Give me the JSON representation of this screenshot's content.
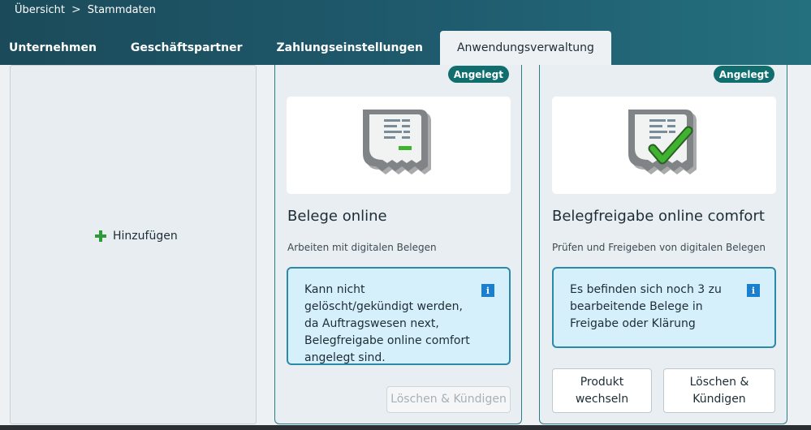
{
  "breadcrumb": {
    "items": [
      "Übersicht",
      "Stammdaten"
    ],
    "separator": ">"
  },
  "tabs": [
    {
      "label": "Unternehmen",
      "active": false
    },
    {
      "label": "Geschäftspartner",
      "active": false
    },
    {
      "label": "Zahlungseinstellungen",
      "active": false
    },
    {
      "label": "Anwendungsverwaltung",
      "active": true
    }
  ],
  "add_card": {
    "label": "Hinzufügen",
    "icon": "plus-icon"
  },
  "apps": [
    {
      "badge": "Angelegt",
      "title": "Belege online",
      "subtitle": "Arbeiten mit digitalen Belegen",
      "info": "Kann nicht gelöscht/gekündigt werden, da Auftragswesen next, Belegfreigabe online comfort angelegt sind.",
      "icon": "receipt-icon",
      "delete_label": "Löschen & Kündigen"
    },
    {
      "badge": "Angelegt",
      "title": "Belegfreigabe online comfort",
      "subtitle": "Prüfen und Freigeben von digitalen Belegen",
      "info": "Es befinden sich noch 3 zu bearbeitende Belege in Freigabe oder Klärung",
      "icon": "receipt-approved-icon",
      "change_label": "Produkt wechseln",
      "delete_label": "Löschen & Kündigen"
    }
  ],
  "info_icon": "i",
  "colors": {
    "accent": "#116e6f",
    "header": "#1f5b6e",
    "info_bg": "#d6f0fb",
    "check": "#3fb22f"
  }
}
